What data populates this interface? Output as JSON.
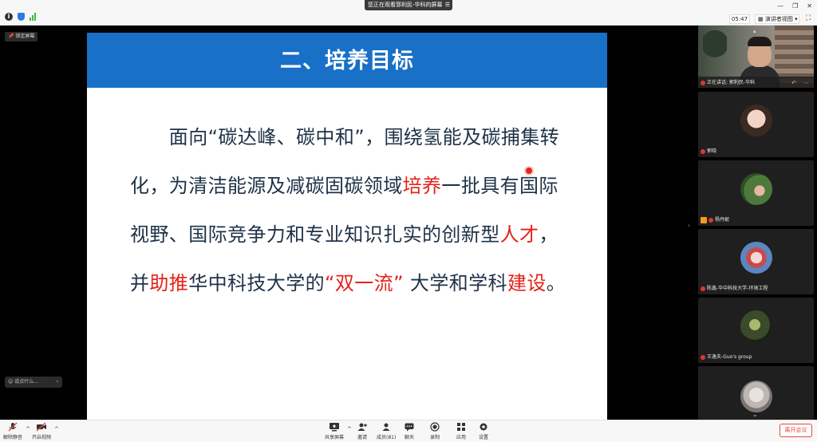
{
  "titlebar": {
    "share_status": "您正在观看郭利民-华科的屏幕",
    "timer": "05:47",
    "view_mode": "演讲者视图"
  },
  "overlay": {
    "lock_screen": "锁定屏幕",
    "chat_placeholder": "说点什么..."
  },
  "slide": {
    "title": "二、培养目标",
    "body": [
      {
        "text": "　　面向“碳达峰、碳中和”，围绕氢能及碳捕集转化，为清洁能源及减碳固碳领域",
        "red": false
      },
      {
        "text": "培养",
        "red": true
      },
      {
        "text": "一批具有国际视野、国际竞争力和专业知识扎实的创新型",
        "red": false
      },
      {
        "text": "人才",
        "red": true
      },
      {
        "text": "，并",
        "red": false
      },
      {
        "text": "助推",
        "red": true
      },
      {
        "text": "华中科技大学的",
        "red": false
      },
      {
        "text": "“双一流”",
        "red": true
      },
      {
        "text": " 大学和学科",
        "red": false
      },
      {
        "text": "建设",
        "red": true
      },
      {
        "text": "。",
        "red": false
      }
    ]
  },
  "participants": {
    "speaker_label": "正在讲话: 郭利民-华科",
    "p2": "郭晓",
    "p3": "杨丹妮",
    "p4": "陈鑫-华中科技大学-环境工程",
    "p5": "王逸夫-Guo's group"
  },
  "toolbar": {
    "unmute": "解除静音",
    "start_video": "开启视频",
    "share_screen": "共享屏幕",
    "invite": "邀请",
    "members": "成员(81)",
    "chat": "聊天",
    "record": "录制",
    "apps": "应用",
    "settings": "设置",
    "leave": "离开会议"
  },
  "colors": {
    "slide_header": "#1870c7",
    "highlight_red": "#e32219",
    "body_text": "#1e3247",
    "leave_red": "#e04a3f"
  }
}
